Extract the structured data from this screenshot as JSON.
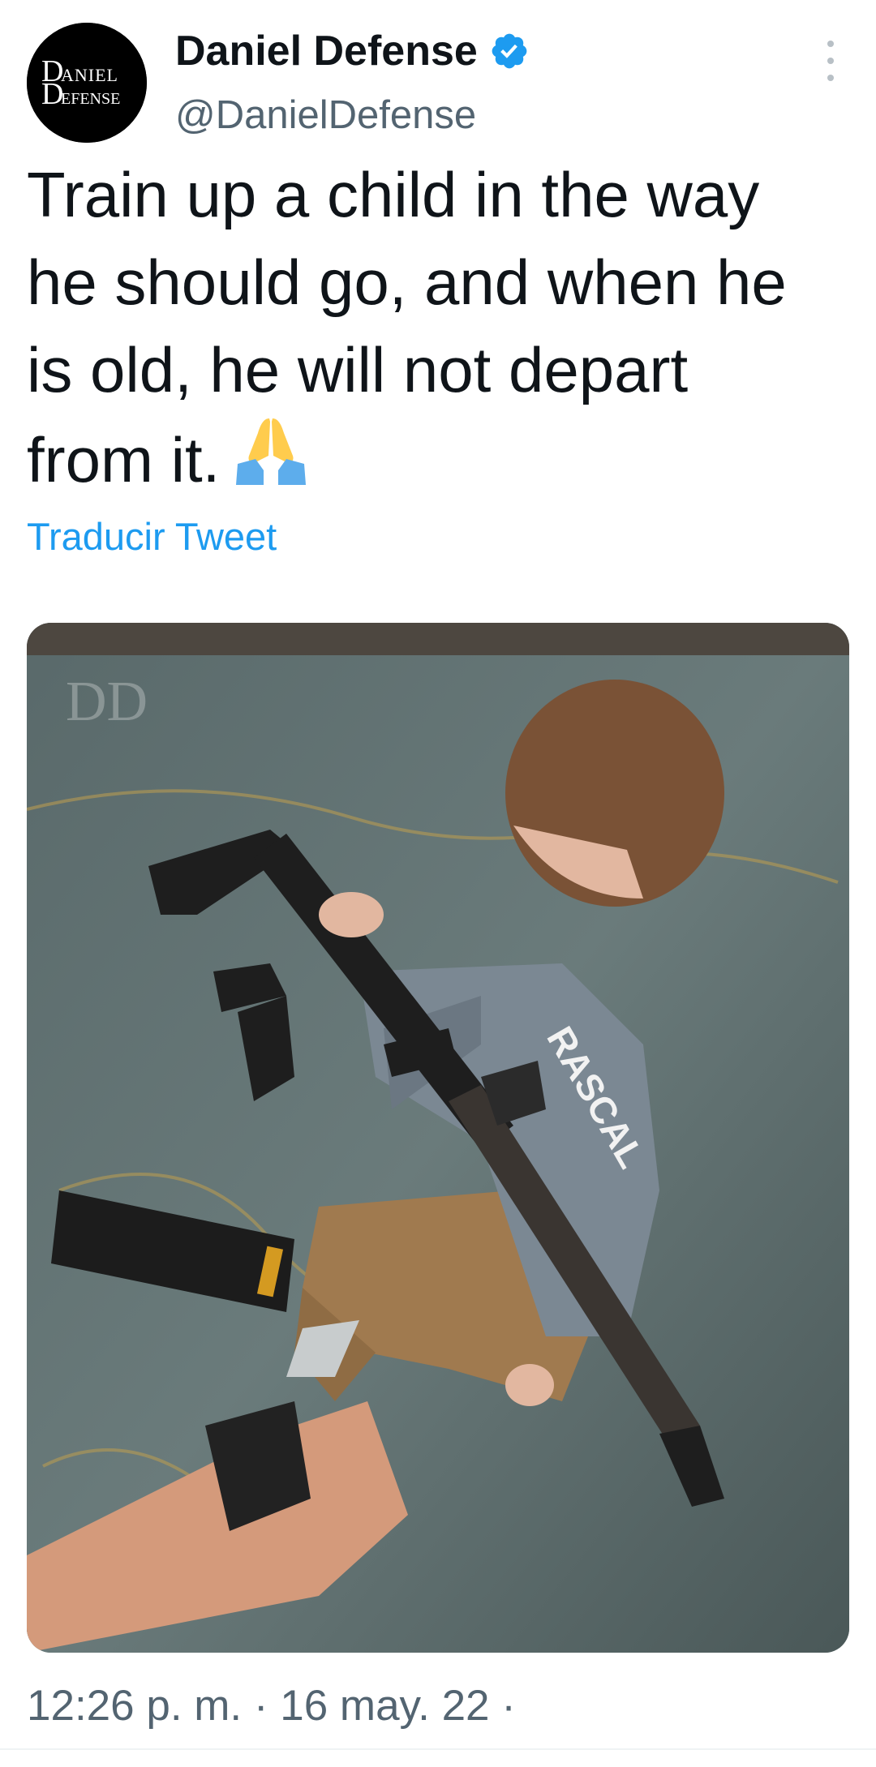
{
  "author": {
    "display_name": "Daniel Defense",
    "handle": "@DanielDefense",
    "avatar_logo_text": "DANIEL DEFENSE",
    "verified": true
  },
  "tweet": {
    "text": "Train up a child in the way\nhe should go, and when he\nis old, he will not depart\nfrom it.",
    "emoji": "folded-hands-icon",
    "translate_link": "Traducir Tweet"
  },
  "media": {
    "watermark_text": "DD",
    "shirt_text": "RASCAL"
  },
  "meta": {
    "timestamp": "12:26 p. m. · 16 may. 22 ·"
  },
  "colors": {
    "link": "#1d9bf0",
    "secondary_text": "#536471",
    "verified": "#1d9bf0"
  }
}
